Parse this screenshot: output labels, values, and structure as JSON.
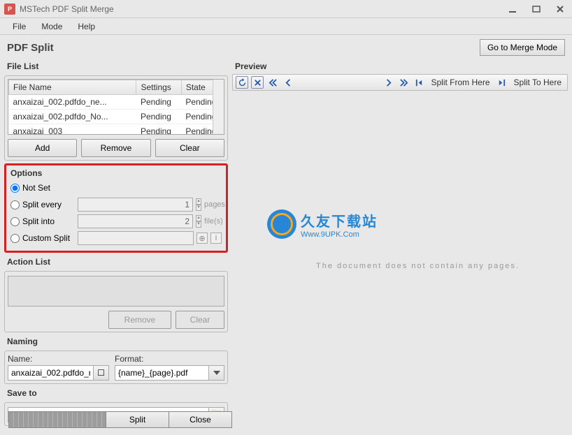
{
  "titlebar": {
    "app_name": "MSTech PDF Split Merge"
  },
  "menu": {
    "file": "File",
    "mode": "Mode",
    "help": "Help"
  },
  "header": {
    "title": "PDF Split",
    "merge_button": "Go to Merge Mode"
  },
  "file_list": {
    "label": "File List",
    "columns": {
      "name": "File Name",
      "settings": "Settings",
      "state": "State"
    },
    "rows": [
      {
        "name": "anxaizai_002.pdfdo_ne...",
        "settings": "Pending",
        "state": "Pending"
      },
      {
        "name": "anxaizai_002.pdfdo_No...",
        "settings": "Pending",
        "state": "Pending"
      },
      {
        "name": "anxaizai_003",
        "settings": "Pending",
        "state": "Pending"
      }
    ],
    "buttons": {
      "add": "Add",
      "remove": "Remove",
      "clear": "Clear"
    }
  },
  "options": {
    "label": "Options",
    "not_set": "Not Set",
    "split_every": "Split every",
    "split_every_value": "1",
    "split_every_unit": "pages",
    "split_into": "Split into",
    "split_into_value": "2",
    "split_into_unit": "file(s)",
    "custom": "Custom Split",
    "custom_value": ""
  },
  "action_list": {
    "label": "Action List",
    "buttons": {
      "remove": "Remove",
      "clear": "Clear"
    }
  },
  "naming": {
    "label": "Naming",
    "name_label": "Name:",
    "name_value": "anxaizai_002.pdfdo_r",
    "format_label": "Format:",
    "format_value": "{name}_{page}.pdf"
  },
  "save_to": {
    "label": "Save to",
    "path": ""
  },
  "bottom": {
    "split": "Split",
    "close": "Close"
  },
  "preview": {
    "label": "Preview",
    "split_from": "Split From Here",
    "split_to": "Split To Here",
    "empty_msg": "The document does not contain any pages."
  },
  "watermark": {
    "cn": "久友下载站",
    "en": "Www.9UPK.Com"
  }
}
